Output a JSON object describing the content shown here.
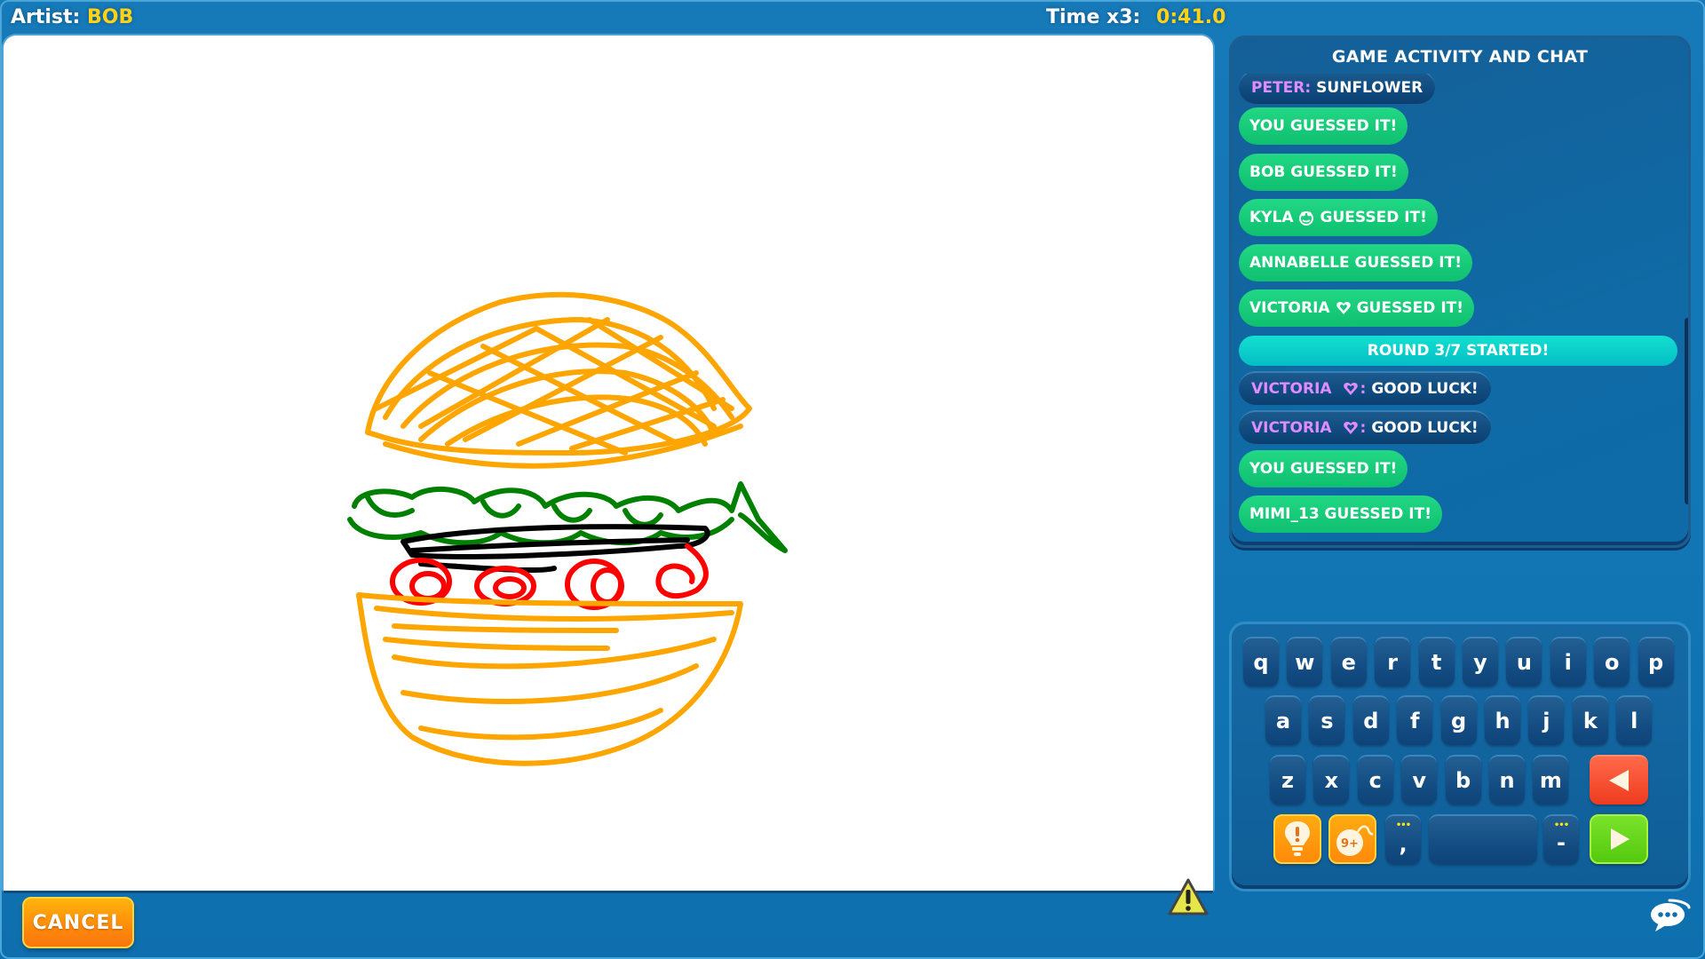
{
  "header": {
    "artist_label": "Artist:",
    "artist_name": "BOB",
    "timer_label": "Time x3:",
    "timer_value": "0:41.0"
  },
  "canvas": {
    "drawing_subject_colors": {
      "bun": "#ffa500",
      "lettuce": "#008000",
      "patty": "#000000",
      "tomato": "#ff0000"
    },
    "report_icon": "warning-icon"
  },
  "chat": {
    "title": "GAME ACTIVITY AND CHAT",
    "messages": [
      {
        "type": "chat",
        "user": "PETER:",
        "text": "SUNFLOWER"
      },
      {
        "type": "guess",
        "text": "YOU GUESSED IT!"
      },
      {
        "type": "guess",
        "text": "BOB GUESSED IT!"
      },
      {
        "type": "guess",
        "user": "KYLA",
        "badge": "frog-icon",
        "text": "GUESSED IT!"
      },
      {
        "type": "guess",
        "text": "ANNABELLE GUESSED IT!"
      },
      {
        "type": "guess",
        "user": "VICTORIA",
        "badge": "heart-icon",
        "text": "GUESSED IT!"
      },
      {
        "type": "round",
        "text": "ROUND 3/7 STARTED!"
      },
      {
        "type": "chat",
        "user": "VICTORIA",
        "badge": "heart-icon",
        "suffix": ":",
        "text": "GOOD LUCK!"
      },
      {
        "type": "chat",
        "user": "VICTORIA",
        "badge": "heart-icon",
        "suffix": ":",
        "text": "GOOD LUCK!"
      },
      {
        "type": "guess",
        "text": "YOU GUESSED IT!"
      },
      {
        "type": "guess",
        "text": "MIMI_13 GUESSED IT!"
      }
    ]
  },
  "keyboard": {
    "row1": [
      "q",
      "w",
      "e",
      "r",
      "t",
      "y",
      "u",
      "i",
      "o",
      "p"
    ],
    "row2": [
      "a",
      "s",
      "d",
      "f",
      "g",
      "h",
      "j",
      "k",
      "l"
    ],
    "row3": [
      "z",
      "x",
      "c",
      "v",
      "b",
      "n",
      "m"
    ],
    "comma_key": ",",
    "dash_key": "-",
    "more_dots": "•••",
    "hint_icon": "lightbulb-icon",
    "bomb_label": "9+",
    "backspace_icon": "backspace-arrow-icon",
    "submit_icon": "play-arrow-icon"
  },
  "footer": {
    "cancel_label": "CANCEL",
    "chat_toggle_icon": "chat-bubble-icon"
  },
  "colors": {
    "accent_yellow": "#ffd21a",
    "guess_green": "#15c97a",
    "round_cyan": "#0ccfcb",
    "username_purple": "#e08bff",
    "cancel_orange": "#ff8a0a"
  }
}
